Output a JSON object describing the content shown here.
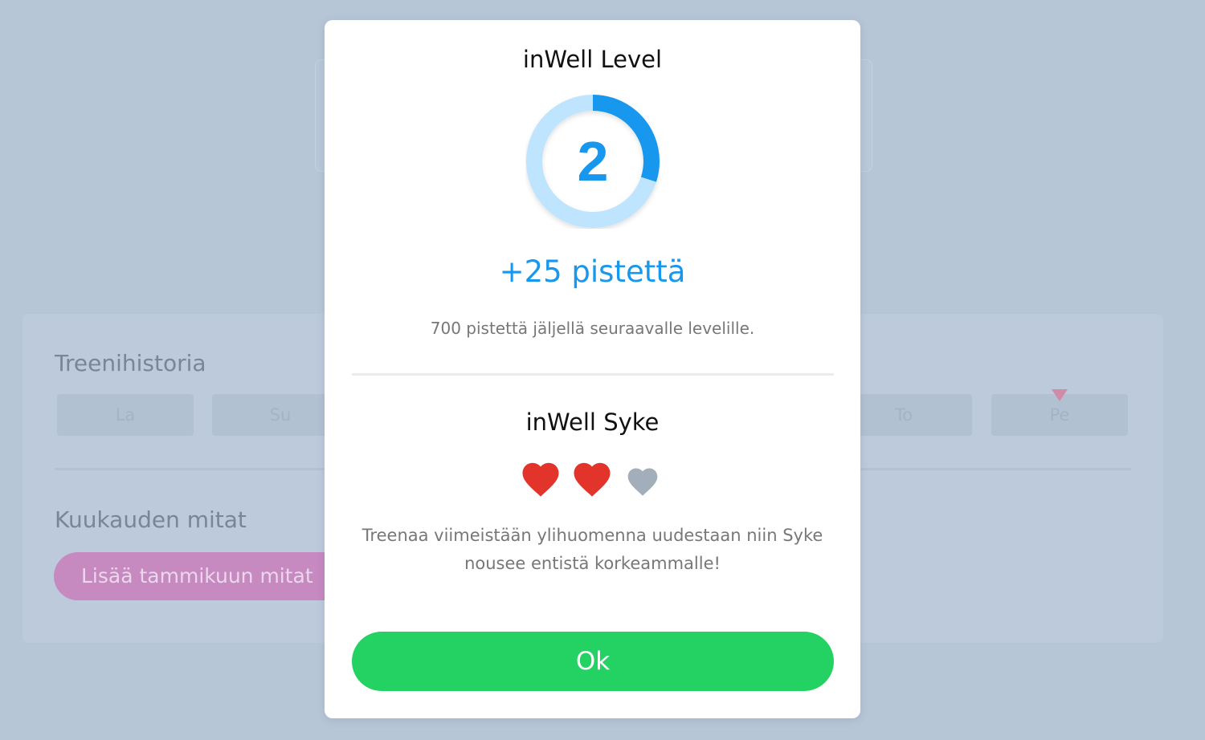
{
  "background": {
    "history_title": "Treenihistoria",
    "days": [
      "La",
      "Su",
      "To",
      "Pe"
    ],
    "measurements_title": "Kuukauden mitat",
    "add_measurements_label": "Lisää tammikuun mitat"
  },
  "modal": {
    "level_title": "inWell Level",
    "level_value": "2",
    "level_progress_fraction": 0.3,
    "points_earned": "+25 pistettä",
    "points_remaining": "700 pistettä jäljellä seuraavalle levelille.",
    "syke_title": "inWell Syke",
    "hearts_filled": 2,
    "hearts_total": 3,
    "syke_message": "Treenaa viimeistään ylihuomenna uudestaan niin Syke nousee entistä korkeammalle!",
    "ok_label": "Ok"
  },
  "colors": {
    "accent_blue": "#1797ee",
    "ring_track": "#bfe4fd",
    "heart_filled": "#e2342a",
    "heart_empty": "#a3aebb",
    "ok_green": "#23d263",
    "overlay": "#b6c6d7"
  },
  "icons": {
    "heart": "heart-icon"
  }
}
